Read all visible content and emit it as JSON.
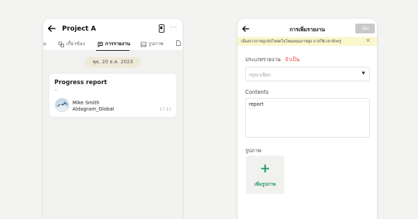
{
  "left": {
    "project_title": "Project A",
    "more_glyph": "···",
    "tabs": [
      {
        "label": "ม",
        "icon": "truncated-tab-icon"
      },
      {
        "label": "เกี่ยวข้อง",
        "icon": "related-icon"
      },
      {
        "label": "การรายงาน",
        "icon": "report-chat-icon",
        "active": true
      },
      {
        "label": "รูปภาพ",
        "icon": "image-icon"
      },
      {
        "label": "",
        "icon": "document-icon"
      }
    ],
    "date_label": "พุธ, 20 ธ.ค. 2023",
    "card": {
      "title": "Progress report",
      "description": "-",
      "user_name": "Mike Smith",
      "user_org": "Aldagram_Global",
      "time": "17:11"
    }
  },
  "right": {
    "title": "การเพิ่มรายงาน",
    "add_button": "เพิ่ม",
    "banner_text": "เนื่องจากภาพถูกอัปโหลดในโหมดคุณภาพสูง อาจใช้เวลาสักครู่",
    "report_type_label": "ประเภทรายงาน",
    "required_label": "จำเป็น",
    "select_placeholder": "กรุณาเลือก",
    "contents_label": "Contents",
    "contents_value": "report",
    "photo_label": "รูปภาพ",
    "add_photo_label": "เพิ่มรูปภาพ"
  },
  "colors": {
    "accent_green": "#1f9a64",
    "required_red": "#e23b3b",
    "banner_yellow": "#fbf6cc",
    "disabled_button": "#c8c8c8"
  }
}
